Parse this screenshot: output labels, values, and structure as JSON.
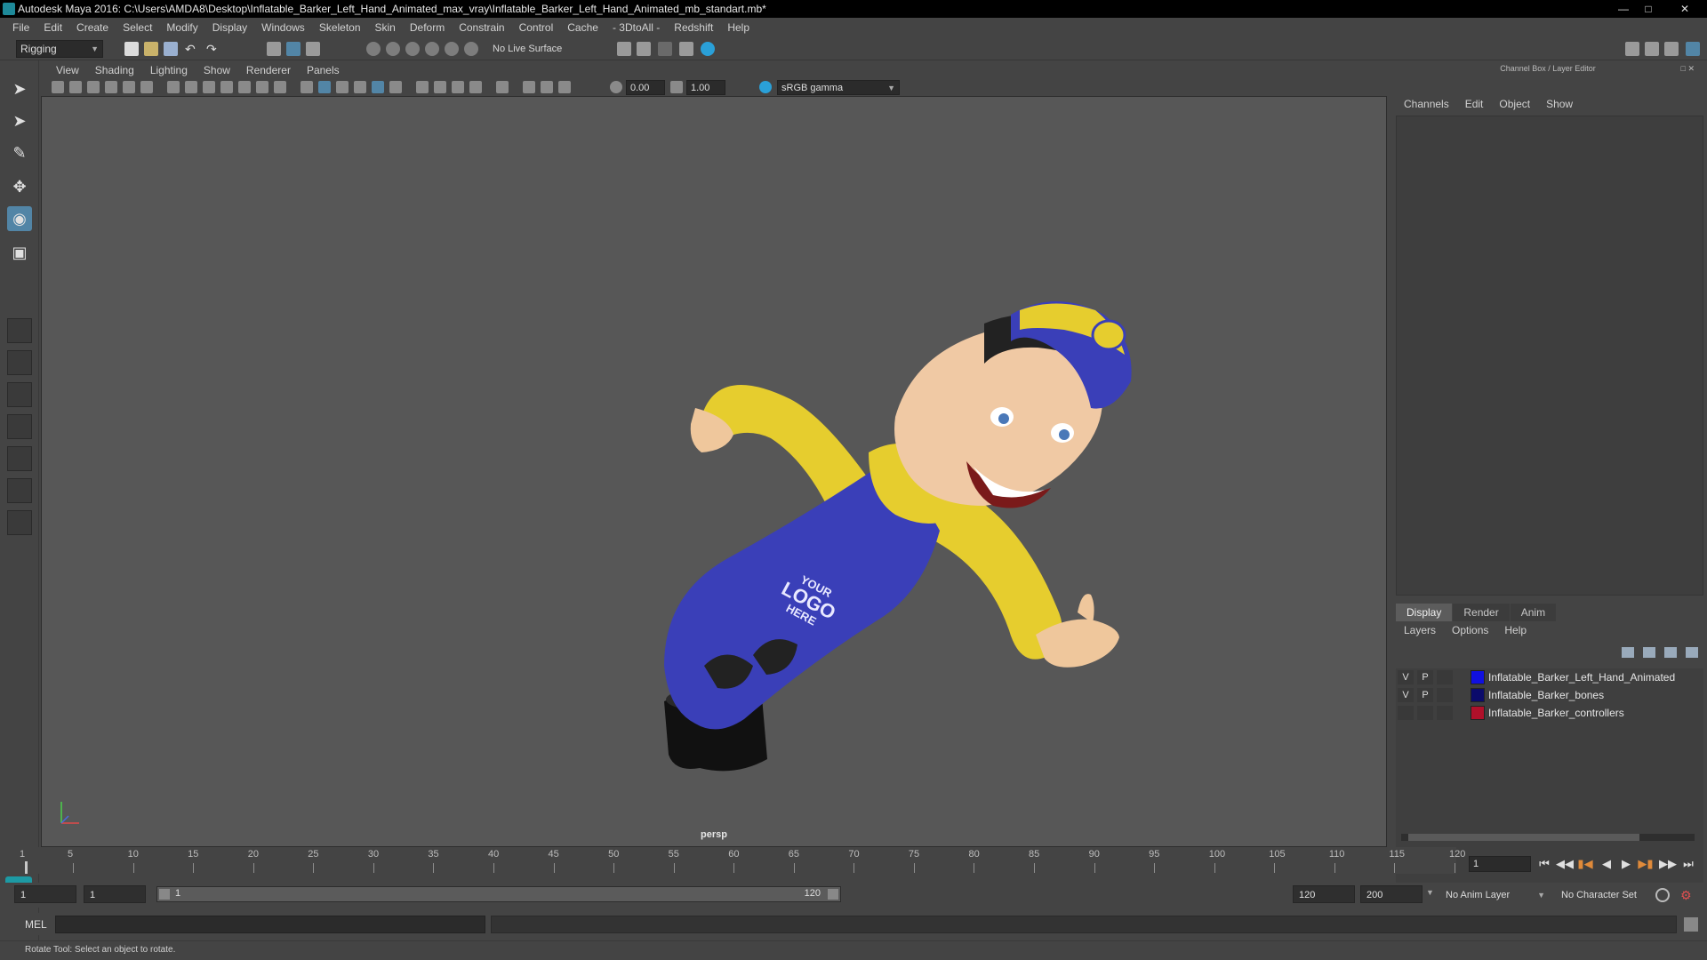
{
  "window": {
    "title": "Autodesk Maya 2016: C:\\Users\\AMDA8\\Desktop\\Inflatable_Barker_Left_Hand_Animated_max_vray\\Inflatable_Barker_Left_Hand_Animated_mb_standart.mb*"
  },
  "menubar": {
    "items": [
      "File",
      "Edit",
      "Create",
      "Select",
      "Modify",
      "Display",
      "Windows",
      "Skeleton",
      "Skin",
      "Deform",
      "Constrain",
      "Control",
      "Cache",
      "- 3DtoAll -",
      "Redshift",
      "Help"
    ]
  },
  "statusline": {
    "module": "Rigging",
    "live_surface": "No Live Surface"
  },
  "viewport": {
    "menu": [
      "View",
      "Shading",
      "Lighting",
      "Show",
      "Renderer",
      "Panels"
    ],
    "exposure": "0.00",
    "gamma": "1.00",
    "color_space": "sRGB gamma",
    "camera": "persp",
    "logo_text": [
      "YOUR",
      "LOGO",
      "HERE"
    ]
  },
  "right_panel": {
    "title": "Channel Box / Layer Editor",
    "menu": [
      "Channels",
      "Edit",
      "Object",
      "Show"
    ],
    "layer_tabs": [
      "Display",
      "Render",
      "Anim"
    ],
    "layer_menu": [
      "Layers",
      "Options",
      "Help"
    ],
    "layers": [
      {
        "v": "V",
        "p": "P",
        "color": "#1010e0",
        "name": "Inflatable_Barker_Left_Hand_Animated"
      },
      {
        "v": "V",
        "p": "P",
        "color": "#0b0b6b",
        "name": "Inflatable_Barker_bones"
      },
      {
        "v": "",
        "p": "",
        "color": "#b0102a",
        "name": "Inflatable_Barker_controllers"
      }
    ]
  },
  "timeline": {
    "ticks": [
      "1",
      "5",
      "10",
      "15",
      "20",
      "25",
      "30",
      "35",
      "40",
      "45",
      "50",
      "55",
      "60",
      "65",
      "70",
      "75",
      "80",
      "85",
      "90",
      "95",
      "100",
      "105",
      "110",
      "115",
      "120"
    ],
    "current_frame": "1"
  },
  "range": {
    "start": "1",
    "playback_start": "1",
    "slider_start": "1",
    "slider_end": "120",
    "playback_end": "120",
    "end": "200",
    "anim_layer": "No Anim Layer",
    "char_set": "No Character Set"
  },
  "command": {
    "label": "MEL"
  },
  "help_line": "Rotate Tool: Select an object to rotate.",
  "colors": {
    "accent": "#5285a6",
    "overall_blue": "#3a3fb8",
    "shirt_yellow": "#e6cd2e",
    "viewport_bg": "#575757"
  }
}
